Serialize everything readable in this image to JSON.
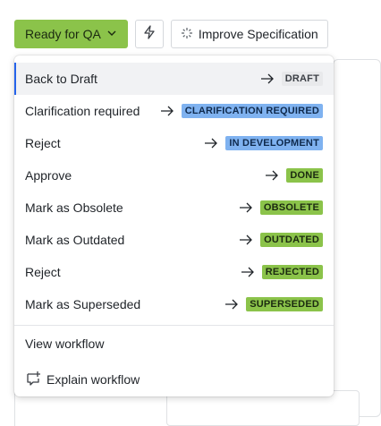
{
  "toolbar": {
    "status_label": "Ready for QA",
    "status_color": "#8bc34a",
    "lightning_icon": "lightning-icon",
    "improve_label": "Improve Specification",
    "improve_icon": "sparkle-icon"
  },
  "menu": {
    "items": [
      {
        "label": "Back to Draft",
        "target": "DRAFT",
        "badge_bg": "#e8e9eb",
        "badge_fg": "#3b3f45",
        "active": true
      },
      {
        "label": "Clarification required",
        "target": "CLARIFICATION REQUIRED",
        "badge_bg": "#7fb2f0",
        "badge_fg": "#0f2a4d"
      },
      {
        "label": "Reject",
        "target": "IN DEVELOPMENT",
        "badge_bg": "#7fb2f0",
        "badge_fg": "#0f2a4d"
      },
      {
        "label": "Approve",
        "target": "DONE",
        "badge_bg": "#8bc34a",
        "badge_fg": "#1b2a10"
      },
      {
        "label": "Mark as Obsolete",
        "target": "OBSOLETE",
        "badge_bg": "#8bc34a",
        "badge_fg": "#1b2a10"
      },
      {
        "label": "Mark as Outdated",
        "target": "OUTDATED",
        "badge_bg": "#8bc34a",
        "badge_fg": "#1b2a10"
      },
      {
        "label": "Reject",
        "target": "REJECTED",
        "badge_bg": "#8bc34a",
        "badge_fg": "#1b2a10"
      },
      {
        "label": "Mark as Superseded",
        "target": "SUPERSEDED",
        "badge_bg": "#8bc34a",
        "badge_fg": "#1b2a10"
      }
    ],
    "view_workflow": "View workflow",
    "explain_workflow": "Explain workflow",
    "explain_icon": "chat-sparkle-icon"
  }
}
